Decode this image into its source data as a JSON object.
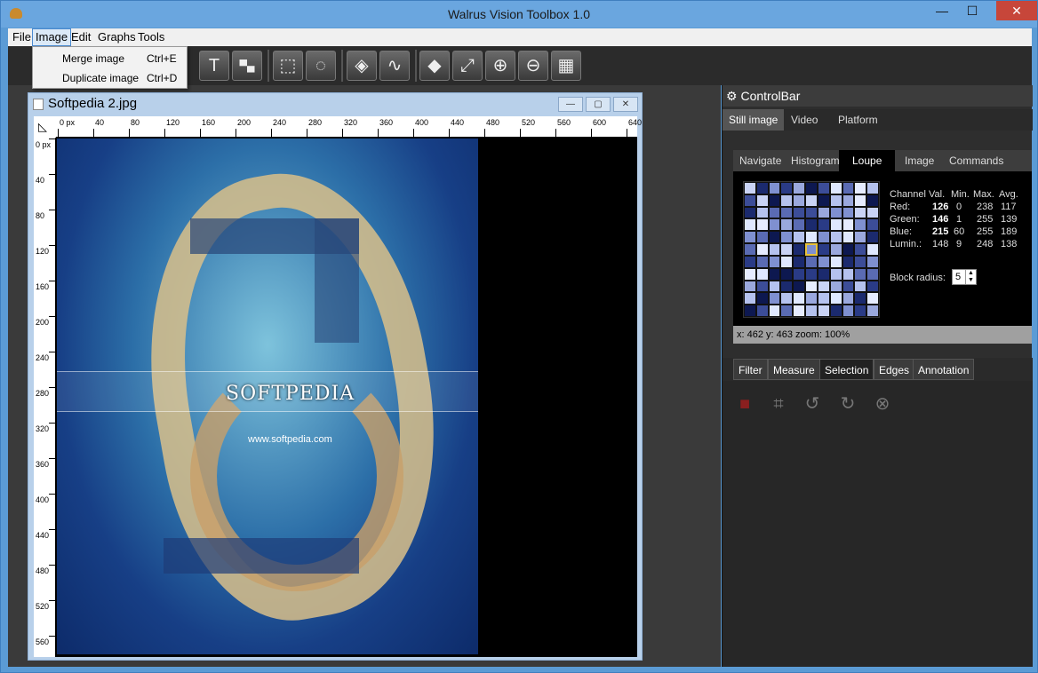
{
  "window": {
    "title": "Walrus Vision Toolbox 1.0",
    "min_label": "—",
    "max_label": "☐",
    "close_label": "✕"
  },
  "menubar": {
    "items": [
      "File",
      "Image",
      "Edit",
      "Graphs",
      "Tools"
    ]
  },
  "image_menu": {
    "items": [
      {
        "label": "Merge image",
        "shortcut": "Ctrl+E"
      },
      {
        "label": "Duplicate image",
        "shortcut": "Ctrl+D"
      }
    ]
  },
  "toolbar": {
    "icons": [
      "text-tool-icon",
      "pattern-icon",
      "rect-select-icon",
      "ellipse-select-icon",
      "bucket-icon",
      "curve-icon",
      "eraser-icon",
      "resize-icon",
      "zoom-in-icon",
      "zoom-out-icon",
      "grid-icon"
    ]
  },
  "image_window": {
    "title": "Softpedia 2.jpg",
    "h_ruler": [
      "0 px",
      "40",
      "80",
      "120",
      "160",
      "200",
      "240",
      "280",
      "320",
      "360",
      "400",
      "440",
      "480",
      "520",
      "560",
      "600",
      "640"
    ],
    "v_ruler": [
      "0 px",
      "40",
      "80",
      "120",
      "160",
      "200",
      "240",
      "280",
      "320",
      "360",
      "400",
      "440",
      "480",
      "520",
      "560"
    ],
    "photo_logo": "SOFTPEDIA",
    "photo_url": "www.softpedia.com"
  },
  "controlbar": {
    "title": "ControlBar",
    "mode_tabs": [
      "Still image",
      "Video",
      "Platform"
    ],
    "active_mode": "Still image",
    "view_tabs": [
      "Navigate",
      "Histogram",
      "Loupe",
      "Image",
      "Commands"
    ],
    "active_view": "Loupe",
    "stats_header": [
      "Channel",
      "Val.",
      "Min.",
      "Max.",
      "Avg."
    ],
    "stats_rows": [
      [
        "Red:",
        "126",
        "0",
        "238",
        "117"
      ],
      [
        "Green:",
        "146",
        "1",
        "255",
        "139"
      ],
      [
        "Blue:",
        "215",
        "60",
        "255",
        "189"
      ],
      [
        "Lumin.:",
        "148",
        "9",
        "248",
        "138"
      ]
    ],
    "block_radius_label": "Block radius:",
    "block_radius_value": "5",
    "status_text": "x: 462  y: 463  zoom: 100%",
    "tool_tabs": [
      "Filter",
      "Measure",
      "Selection",
      "Edges",
      "Annotation"
    ],
    "active_tool_tab": "Selection",
    "selection_tools": [
      "stop-icon",
      "crop-icon",
      "rotate-left-icon",
      "rotate-right-icon",
      "cancel-icon"
    ]
  },
  "colors": {
    "accent": "#5b9bd5",
    "panel_bg": "#2e2e2e",
    "loupe_selected": "#e8c23a"
  }
}
